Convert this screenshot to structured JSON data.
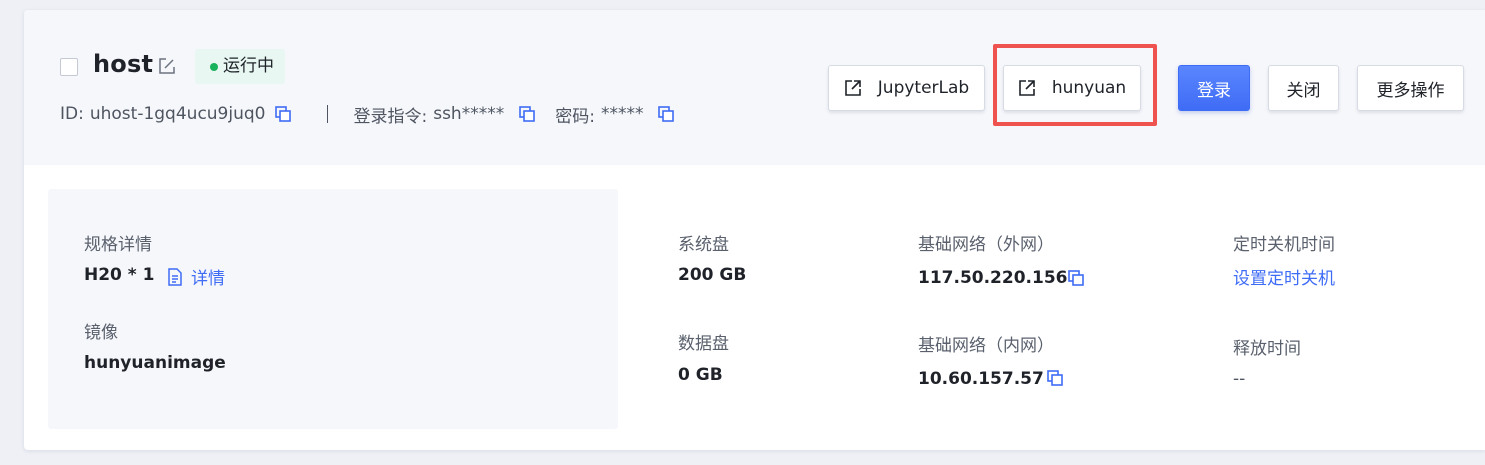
{
  "host": {
    "name": "host",
    "status": "运行中",
    "status_color": "#19b25d",
    "id_label": "ID:",
    "id_value": "uhost-1gq4ucu9juq0",
    "login_cmd_label": "登录指令:",
    "login_cmd_value": "ssh*****",
    "password_label": "密码:",
    "password_value": "*****"
  },
  "actions": {
    "jupyterlab_label": "JupyterLab",
    "hunyuan_label": "hunyuan",
    "login_label": "登录",
    "close_label": "关闭",
    "more_label": "更多操作"
  },
  "spec": {
    "spec_label": "规格详情",
    "spec_value": "H20 * 1",
    "detail_link": "详情",
    "image_label": "镜像",
    "image_value": "hunyuanimage"
  },
  "disks": {
    "system_label": "系统盘",
    "system_value": "200 GB",
    "data_label": "数据盘",
    "data_value": "0 GB"
  },
  "network": {
    "public_label": "基础网络（外网）",
    "public_ip": "117.50.220.156",
    "private_label": "基础网络（内网）",
    "private_ip": "10.60.157.57"
  },
  "schedule": {
    "shutdown_label": "定时关机时间",
    "shutdown_link": "设置定时关机",
    "release_label": "释放时间",
    "release_value": "--"
  },
  "icons": {
    "edit": "edit-icon",
    "copy": "copy-icon",
    "external_link": "external-link-icon",
    "document": "document-icon"
  },
  "colors": {
    "primary": "#3f6cf5",
    "highlight": "#ef5350",
    "status_bg": "#e8f7f1"
  }
}
